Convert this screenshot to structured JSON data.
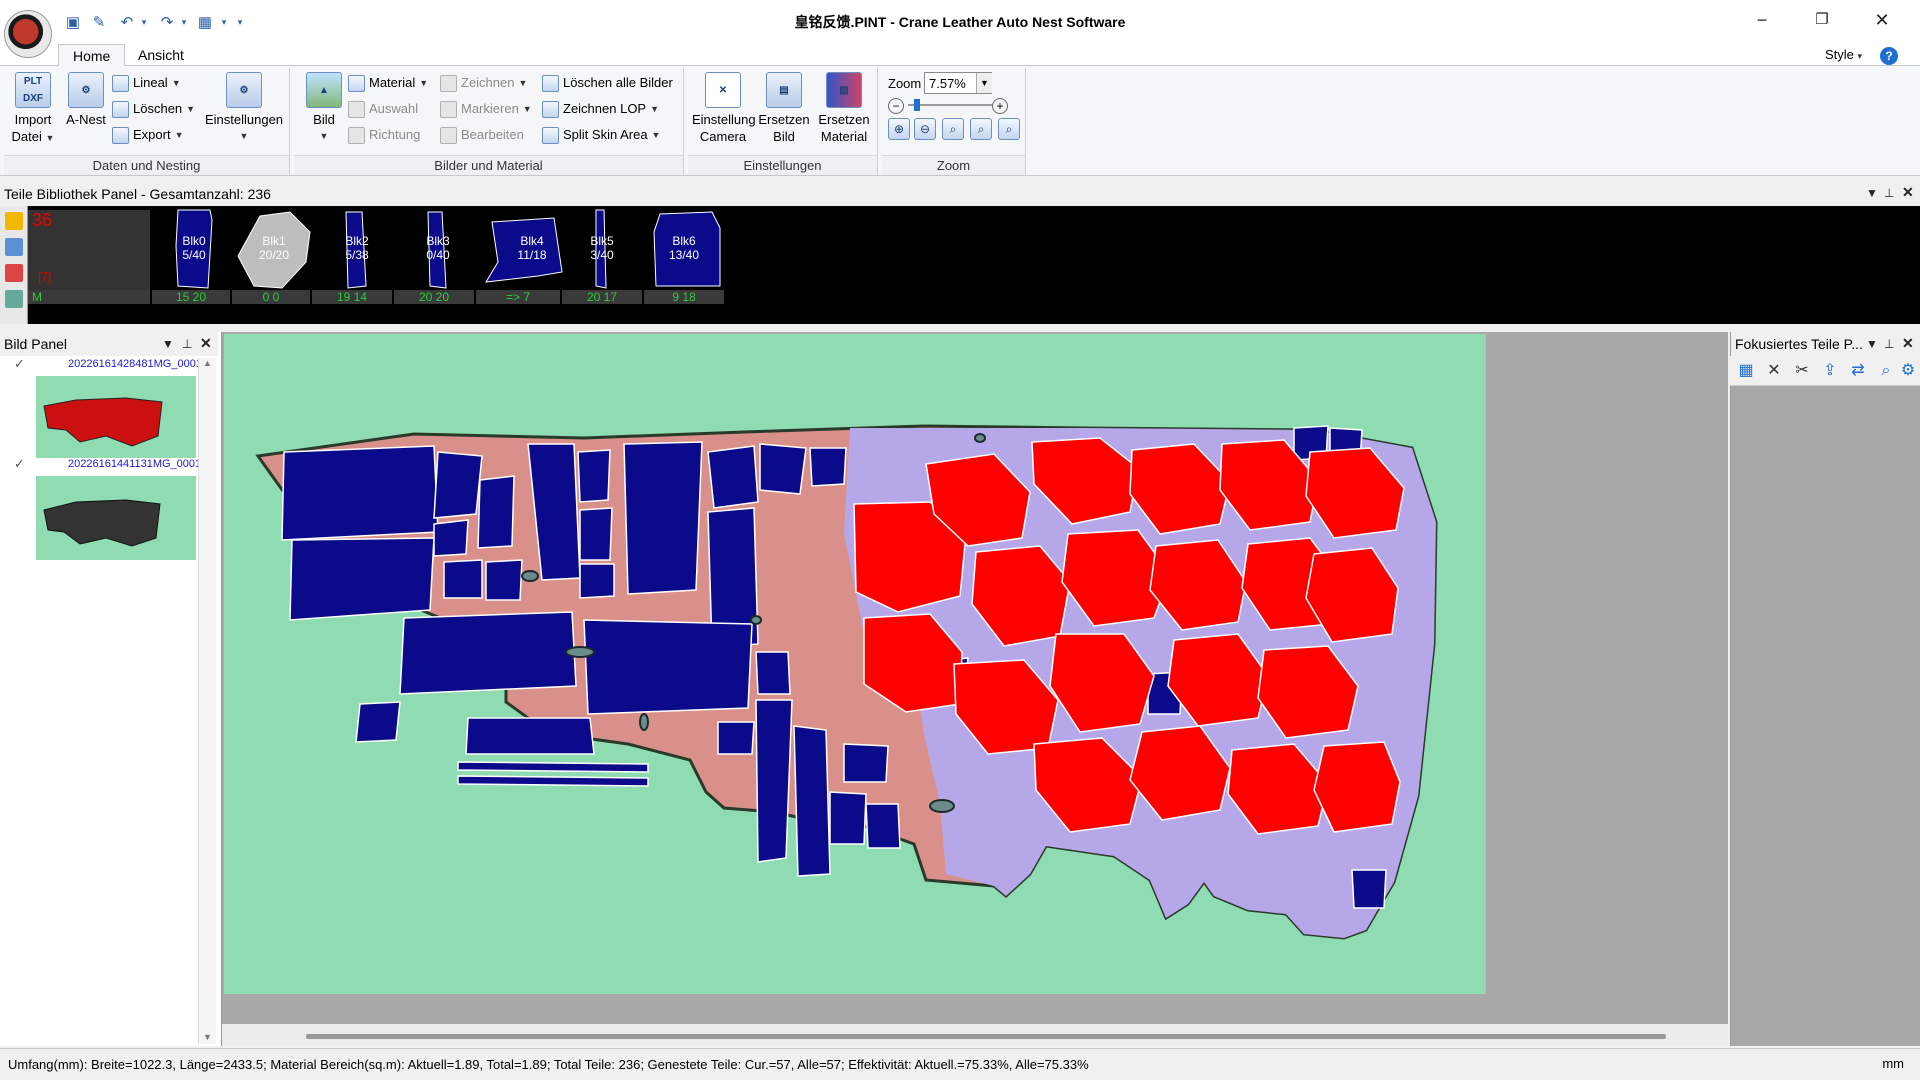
{
  "window": {
    "title": "皇铭反馈.PINT - Crane Leather Auto Nest Software",
    "minimize": "−",
    "restore": "❐",
    "close": "✕"
  },
  "tabs": {
    "home": "Home",
    "view": "Ansicht"
  },
  "style_menu": "Style",
  "help_glyph": "?",
  "ribbon": {
    "daten": {
      "label": "Daten und Nesting",
      "import_line1": "Import",
      "import_line2": "Datei",
      "import_icon_text": "PLT DXF",
      "anest": "A-Nest",
      "lineal": "Lineal",
      "loeschen": "Löschen",
      "export": "Export",
      "einstellungen": "Einstellungen"
    },
    "bilder": {
      "label": "Bilder und Material",
      "bild": "Bild",
      "material": "Material",
      "auswahl": "Auswahl",
      "richtung": "Richtung",
      "zeichnen": "Zeichnen",
      "markieren": "Markieren",
      "bearbeiten": "Bearbeiten",
      "loeschen_alle": "Löschen alle Bilder",
      "zeichnen_lop": "Zeichnen LOP",
      "split_skin": "Split Skin Area"
    },
    "einstellungen": {
      "label": "Einstellungen",
      "camera_line1": "Einstellung",
      "camera_line2": "Camera",
      "bild_line1": "Ersetzen",
      "bild_line2": "Bild",
      "mat_line1": "Ersetzen",
      "mat_line2": "Material"
    },
    "zoom": {
      "label": "Zoom",
      "field_label": "Zoom",
      "value": "7.57%",
      "minus": "−",
      "plus": "+"
    }
  },
  "library": {
    "title": "Teile Bibliothek Panel - Gesamtanzahl: 236",
    "count": "36",
    "sub": "[7]",
    "summary_foot": "M",
    "pieces": [
      {
        "name": "Blk0",
        "qty": "5/40",
        "foot": "15  20",
        "color": "#0a0a8a"
      },
      {
        "name": "Blk1",
        "qty": "20/20",
        "foot": "0   0",
        "color": "#bdbdbd"
      },
      {
        "name": "Blk2",
        "qty": "5/38",
        "foot": "19  14",
        "color": "#0a0a8a"
      },
      {
        "name": "Blk3",
        "qty": "0/40",
        "foot": "20  20",
        "color": "#0a0a8a"
      },
      {
        "name": "Blk4",
        "qty": "11/18",
        "foot": "=>  7",
        "color": "#0a0a8a"
      },
      {
        "name": "Blk5",
        "qty": "3/40",
        "foot": "20  17",
        "color": "#0a0a8a"
      },
      {
        "name": "Blk6",
        "qty": "13/40",
        "foot": "9   18",
        "color": "#0a0a8a"
      }
    ]
  },
  "bild_panel": {
    "title": "Bild Panel",
    "images": [
      {
        "name": "20226161428481MG_0001"
      },
      {
        "name": "20226161441131MG_0001"
      }
    ]
  },
  "focus_panel": {
    "title": "Fokusiertes Teile P..."
  },
  "status": {
    "text": "Umfang(mm): Breite=1022.3, Länge=2433.5; Material Bereich(sq.m): Aktuell=1.89, Total=1.89; Total Teile: 236; Genestete Teile: Cur.=57, Alle=57; Effektivität: Aktuell.=75.33%, Alle=75.33%",
    "unit": "mm"
  },
  "colors": {
    "nested_blue": "#0a0a8a",
    "nested_red": "#ff0000",
    "leather_pink": "#d9908a",
    "leather_lilac": "#b6a8e8",
    "table_green": "#8fdbb2",
    "accent": "#1f6fd1"
  },
  "icons": [
    "save-icon",
    "undo-icon",
    "redo-icon",
    "dropdown-icon",
    "help-icon",
    "pin-icon",
    "close-icon",
    "zoom-in-icon",
    "zoom-out-icon",
    "zoom-fit-icon"
  ]
}
